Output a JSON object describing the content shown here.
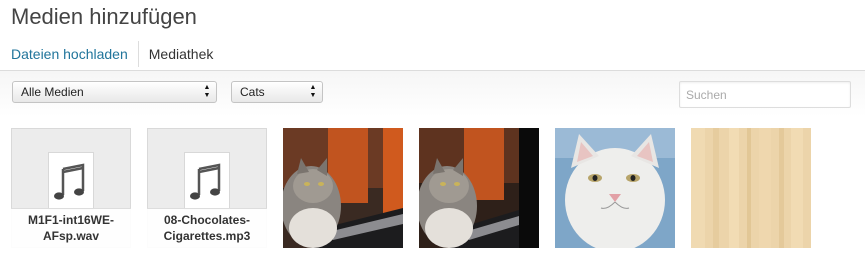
{
  "modal": {
    "title": "Medien hinzufügen"
  },
  "router": {
    "tabs": [
      {
        "label": "Dateien hochladen",
        "active": false
      },
      {
        "label": "Mediathek",
        "active": true
      }
    ]
  },
  "toolbar": {
    "media_filter": {
      "selected": "Alle Medien"
    },
    "category_filter": {
      "selected": "Cats"
    },
    "search": {
      "placeholder": "Suchen",
      "value": ""
    }
  },
  "attachments": [
    {
      "type": "audio",
      "icon": "audio-file-icon",
      "filename_line1": "M1F1-int16WE-",
      "filename_line2": "AFsp.wav"
    },
    {
      "type": "audio",
      "icon": "audio-file-icon",
      "filename_line1": "08-Chocolates-",
      "filename_line2": "Cigarettes.mp3"
    },
    {
      "type": "image",
      "subject": "long-haired grey cat beside laptop"
    },
    {
      "type": "image",
      "subject": "long-haired grey cat beside laptop (cropped)"
    },
    {
      "type": "image",
      "subject": "white cat face"
    },
    {
      "type": "image",
      "subject": "light wood texture"
    }
  ],
  "colors": {
    "link": "#21759b",
    "title": "#444444",
    "tile_background": "#ececec"
  }
}
